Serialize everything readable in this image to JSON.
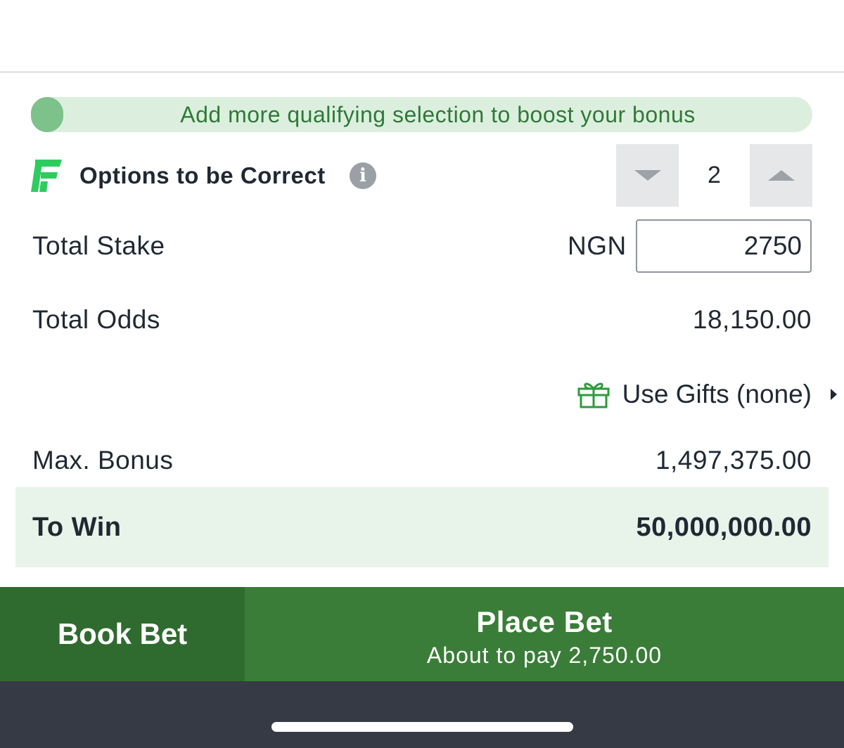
{
  "banner": {
    "text": "Add more qualifying selection to boost your bonus"
  },
  "options": {
    "label": "Options to be Correct",
    "value": "2",
    "info_icon": "i"
  },
  "stake": {
    "label": "Total Stake",
    "currency": "NGN",
    "value": "2750"
  },
  "odds": {
    "label": "Total Odds",
    "value": "18,150.00"
  },
  "gifts": {
    "label": "Use Gifts (none)"
  },
  "bonus": {
    "label": "Max. Bonus",
    "value": "1,497,375.00"
  },
  "to_win": {
    "label": "To Win",
    "value": "50,000,000.00"
  },
  "buttons": {
    "book_bet": "Book Bet",
    "place_bet": "Place Bet",
    "place_bet_sub": "About to pay 2,750.00"
  },
  "colors": {
    "brand_green": "#3a7d38",
    "dark_green": "#2f6b2e",
    "banner_bg": "#dcefdf",
    "banner_text": "#2f7a36",
    "to_win_bg": "#e8f3ea",
    "logo_green": "#2ecc5f",
    "bottom_bar": "#363a45"
  },
  "icons": [
    "logo-icon",
    "info-icon",
    "chevron-down-icon",
    "chevron-up-icon",
    "gift-icon",
    "caret-right-icon"
  ]
}
